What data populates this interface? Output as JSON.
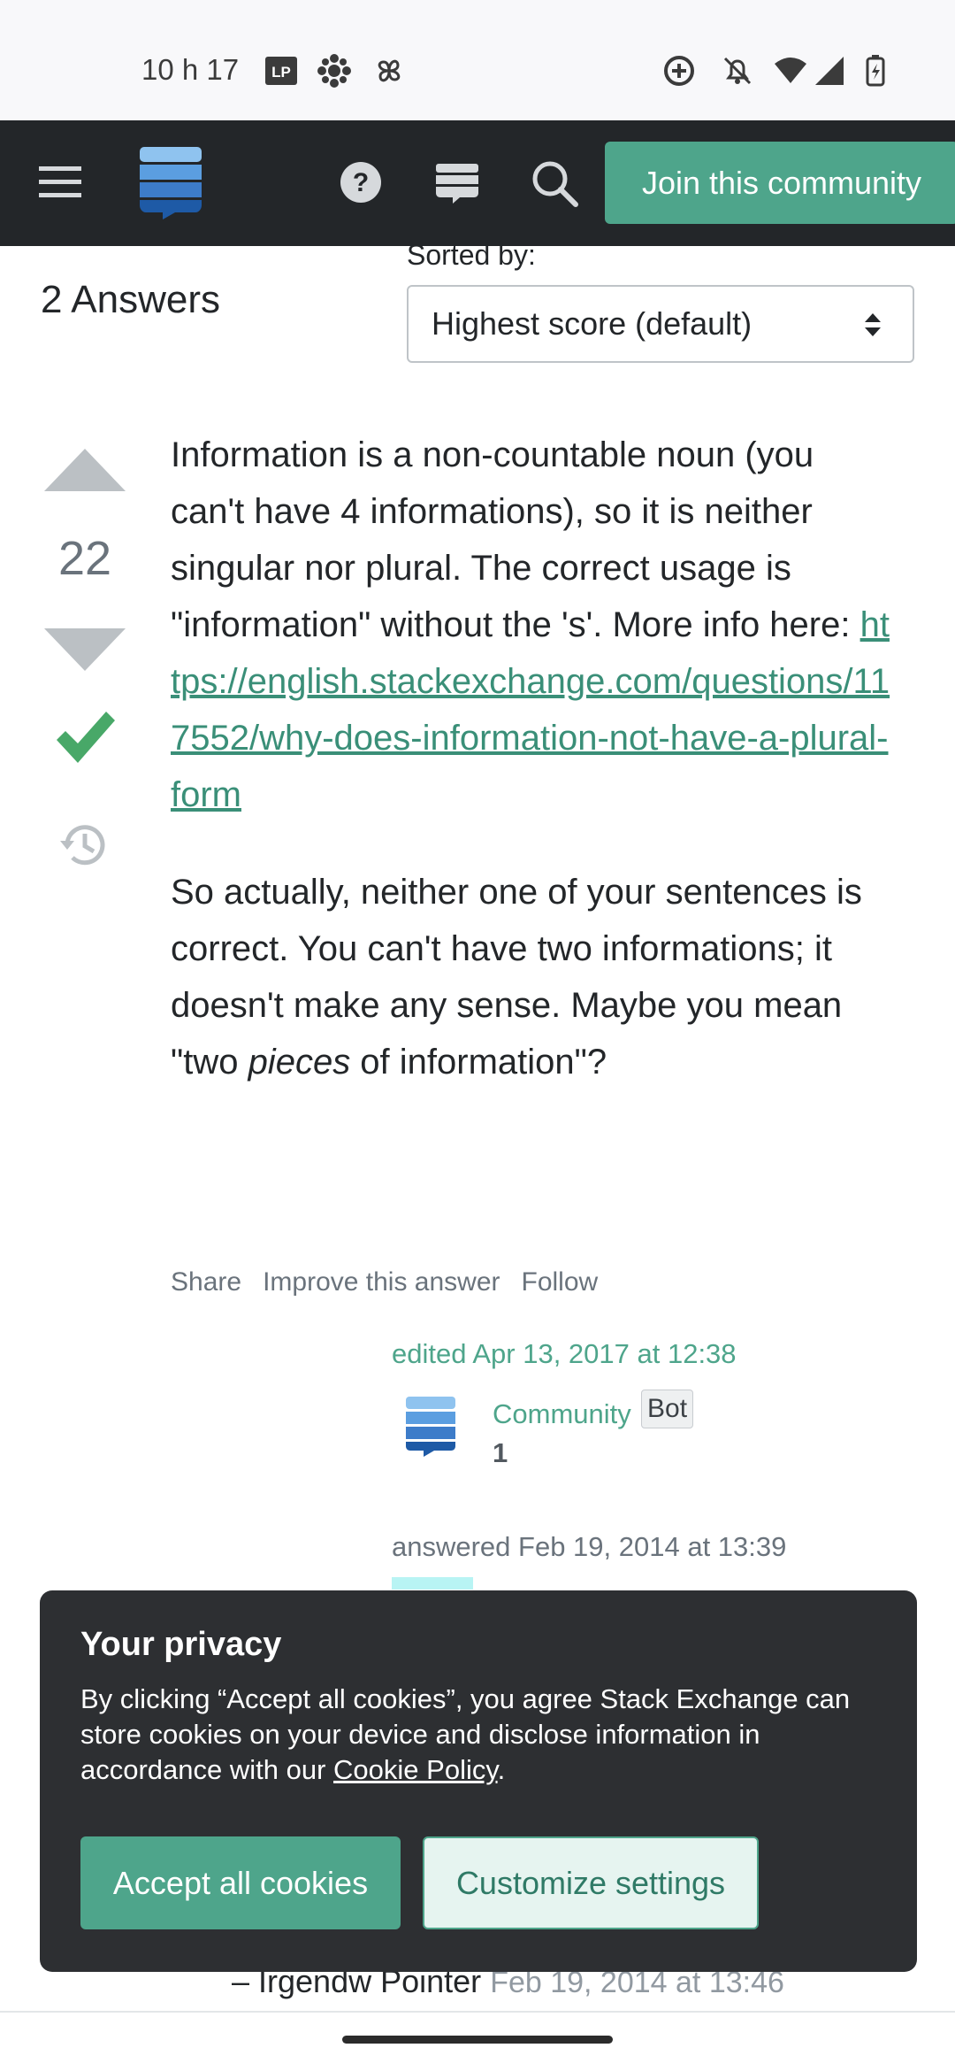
{
  "status_bar": {
    "time": "10 h 17",
    "left_icons": [
      "lp-icon",
      "cbc-icon",
      "pinwheel-icon"
    ],
    "right_icons": [
      "data-saver-icon",
      "bell-off-icon",
      "wifi-icon",
      "signal-icon",
      "battery-icon"
    ]
  },
  "topbar": {
    "join_label": "Join this community",
    "icons": [
      "menu-icon",
      "stackexchange-logo",
      "help-icon",
      "inbox-icon",
      "search-icon"
    ]
  },
  "answers_header": {
    "count_label": "2 Answers",
    "sorted_label": "Sorted by:",
    "sort_value": "Highest score (default)"
  },
  "answer": {
    "score": "22",
    "accepted": true,
    "p1_text": "Information is a non-countable noun (you can't have 4 informations), so it is neither singular nor plural. The correct usage is \"information\" without the 's'. More info here: ",
    "link": "https://english.stackexchange.com/questions/117552/why-does-information-not-have-a-plural-form",
    "p2_before": "So actually, neither one of your sentences is correct. You can't have two informations; it doesn't make any sense. Maybe you mean \"two ",
    "p2_em": "pieces",
    "p2_after": " of information\"?",
    "menu": {
      "share": "Share",
      "improve": "Improve this answer",
      "follow": "Follow"
    },
    "edited": "edited Apr 13, 2017 at 12:38",
    "editor_name": "Community",
    "editor_badge": "Bot",
    "editor_rep": "1",
    "answered": "answered Feb 19, 2014 at 13:39"
  },
  "comment": {
    "author": "– Irgendw Pointer",
    "time": "Feb 19, 2014 at 13:46"
  },
  "cookie_dialog": {
    "title": "Your privacy",
    "text_before": "By clicking “Accept all cookies”, you agree Stack Exchange can store cookies on your device and disclose information in accordance with our ",
    "link": "Cookie Policy",
    "text_after": ".",
    "accept": "Accept all cookies",
    "customize": "Customize settings"
  },
  "colors": {
    "accent": "#4ea58b",
    "topbar_bg": "#232629",
    "dialog_bg": "#2d2f32",
    "accepted_check": "#48a868"
  }
}
